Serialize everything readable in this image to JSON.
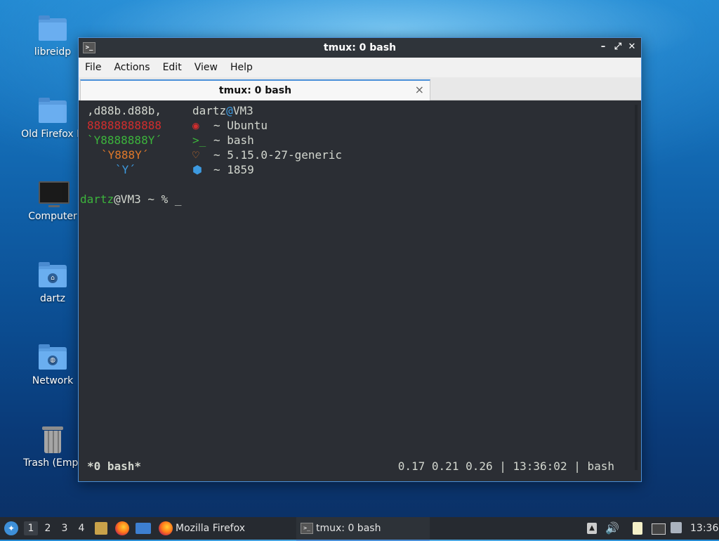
{
  "desktop": {
    "icons": [
      {
        "label": "libreidp",
        "icon": "folder-icon"
      },
      {
        "label": "Old Firefox D",
        "icon": "folder-icon"
      },
      {
        "label": "Computer",
        "icon": "computer-icon"
      },
      {
        "label": "dartz",
        "icon": "home-folder-icon"
      },
      {
        "label": "Network",
        "icon": "network-folder-icon"
      },
      {
        "label": "Trash (Empt",
        "icon": "trash-icon"
      }
    ]
  },
  "window": {
    "title": "tmux: 0 bash",
    "menu": [
      "File",
      "Actions",
      "Edit",
      "View",
      "Help"
    ],
    "tab": {
      "label": "tmux: 0 bash",
      "close": "×"
    },
    "controls": {
      "minimize": "–",
      "maximize": "⤢",
      "close": "✕"
    }
  },
  "terminal": {
    "logo": [
      ",d88b.d88b,",
      "88888888888",
      "`Y8888888Y´",
      "`Y888Y´",
      "`Y´"
    ],
    "user": "dartz",
    "at": "@",
    "host": "VM3",
    "info": [
      {
        "icon": "ubuntu-icon",
        "glyph": "◉",
        "text": "~ Ubuntu",
        "color": "#d22d2d"
      },
      {
        "icon": "terminal-prompt-icon",
        "glyph": ">_",
        "text": "~ bash",
        "color": "#3cb43c"
      },
      {
        "icon": "heart-icon",
        "glyph": "♡",
        "text": "~ 5.15.0-27-generic",
        "color": "#e0782a"
      },
      {
        "icon": "package-icon",
        "glyph": "⬢",
        "text": "~ 1859",
        "color": "#3d9ae0"
      }
    ],
    "prompt": {
      "user": "dartz",
      "host": "@VM3",
      "rest": " ~ % ",
      "cursor": "_"
    },
    "status": {
      "left": "*0 bash*",
      "right": "0.17 0.21 0.26 | 13:36:02 | bash"
    }
  },
  "taskbar": {
    "workspaces": [
      "1",
      "2",
      "3",
      "4"
    ],
    "tasks": [
      {
        "label": "Mozilla Firefox",
        "icon": "firefox-icon"
      },
      {
        "label": "tmux: 0 bash",
        "icon": "terminal-icon"
      }
    ],
    "clock": "13:36"
  },
  "colors": {
    "logo": [
      "#d3d7cf",
      "#d22d2d",
      "#3cb43c",
      "#e0782a",
      "#3d9ae0"
    ],
    "user": "#3cb43c",
    "at": "#3d9ae0",
    "accent": "#4a90d9"
  }
}
